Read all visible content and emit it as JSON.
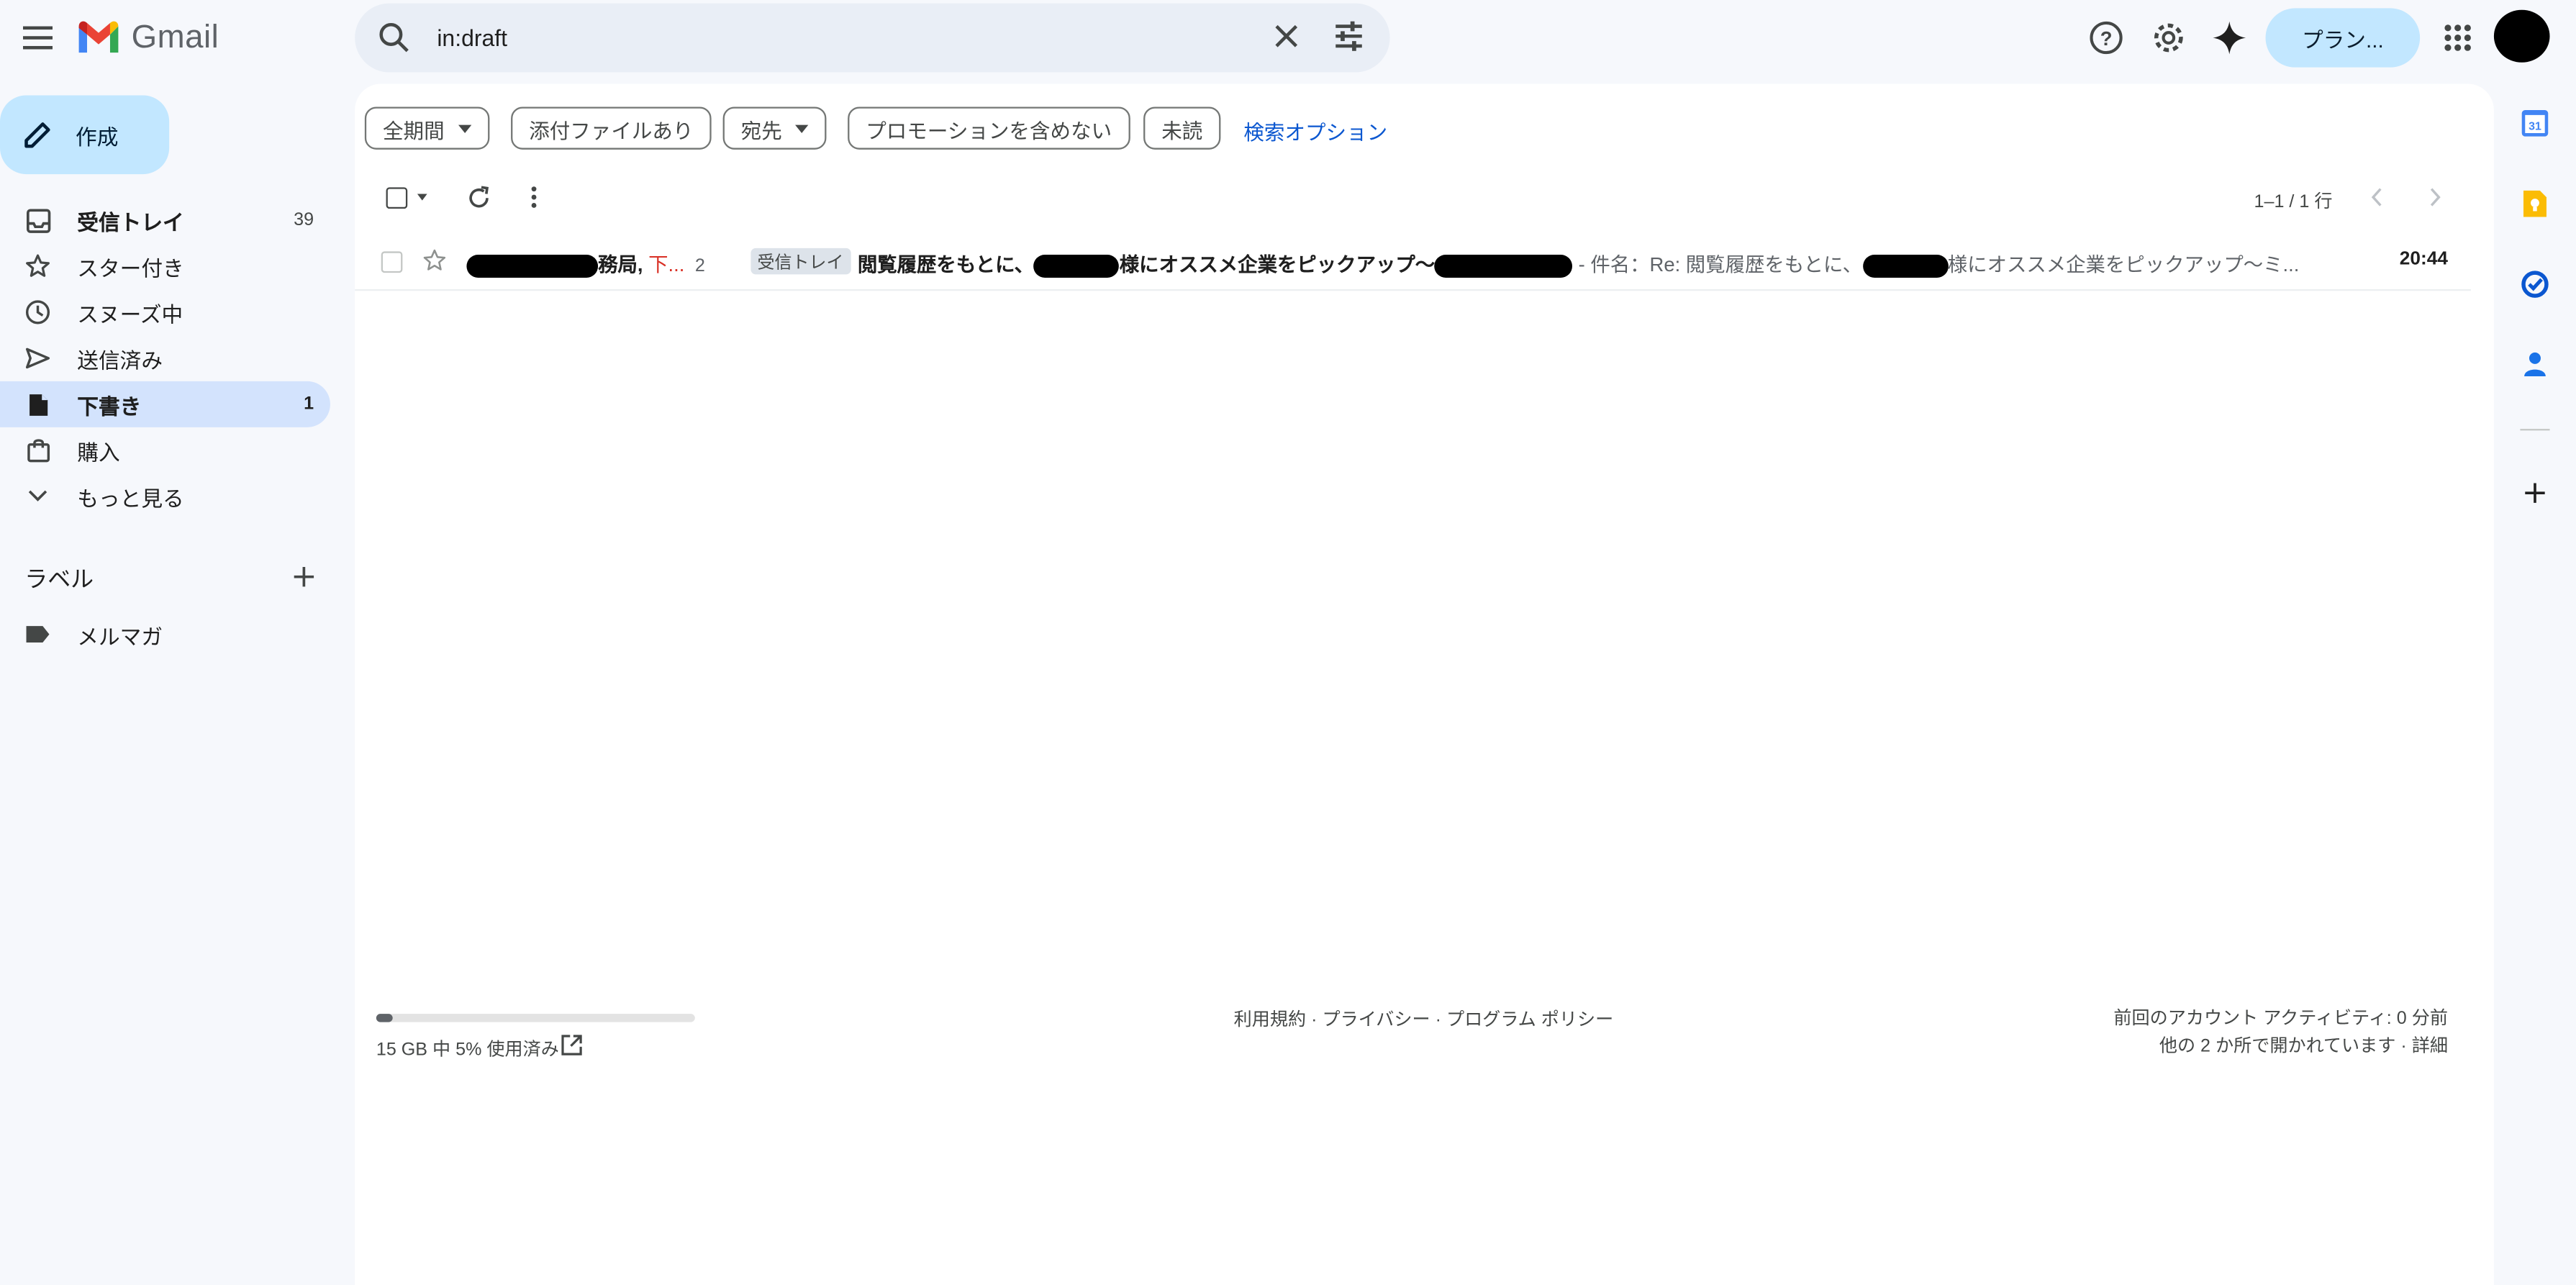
{
  "app": {
    "name": "Gmail"
  },
  "search": {
    "value": "in:draft"
  },
  "top_right": {
    "plan_label": "プラン..."
  },
  "compose": {
    "label": "作成"
  },
  "nav": {
    "items": [
      {
        "label": "受信トレイ",
        "count": "39",
        "icon": "inbox-icon"
      },
      {
        "label": "スター付き",
        "count": "",
        "icon": "star-icon"
      },
      {
        "label": "スヌーズ中",
        "count": "",
        "icon": "clock-icon"
      },
      {
        "label": "送信済み",
        "count": "",
        "icon": "send-icon"
      },
      {
        "label": "下書き",
        "count": "1",
        "icon": "draft-icon"
      },
      {
        "label": "購入",
        "count": "",
        "icon": "shopping-bag-icon"
      },
      {
        "label": "もっと見る",
        "count": "",
        "icon": "chevron-down-icon"
      }
    ],
    "active_index": 4
  },
  "labels": {
    "heading": "ラベル",
    "items": [
      {
        "label": "メルマガ",
        "icon": "label-icon"
      }
    ]
  },
  "filters": {
    "chips": [
      "全期間",
      "添付ファイルあり",
      "宛先",
      "プロモーションを含めない",
      "未読"
    ],
    "advanced_link": "検索オプション"
  },
  "list": {
    "pager": "1–1 / 1 行",
    "rows": [
      {
        "sender_suffix": "務局,",
        "draft_label": "下...",
        "thread_count": "2",
        "tag": "受信トレイ",
        "subject_part1": "閲覧履歴をもとに、",
        "subject_part2": "様にオススメ企業をピックアップ〜",
        "snippet_part1": "- 件名：Re: 閲覧履歴をもとに、",
        "snippet_part2": "様にオススメ企業をピックアップ〜ミ...",
        "time": "20:44"
      }
    ]
  },
  "footer": {
    "storage_text": "15 GB 中 5% 使用済み",
    "storage_fraction": 0.05,
    "policy": "利用規約 · プライバシー · プログラム ポリシー",
    "activity_line1": "前回のアカウント アクティビティ: 0 分前",
    "activity_line2": "他の 2 か所で開かれています · 詳細"
  },
  "colors": {
    "background": "#f6f8fc",
    "compose": "#c2e7ff",
    "active_nav": "#d3e3fd",
    "accent_link": "#0b57d0",
    "draft_red": "#d93025"
  }
}
